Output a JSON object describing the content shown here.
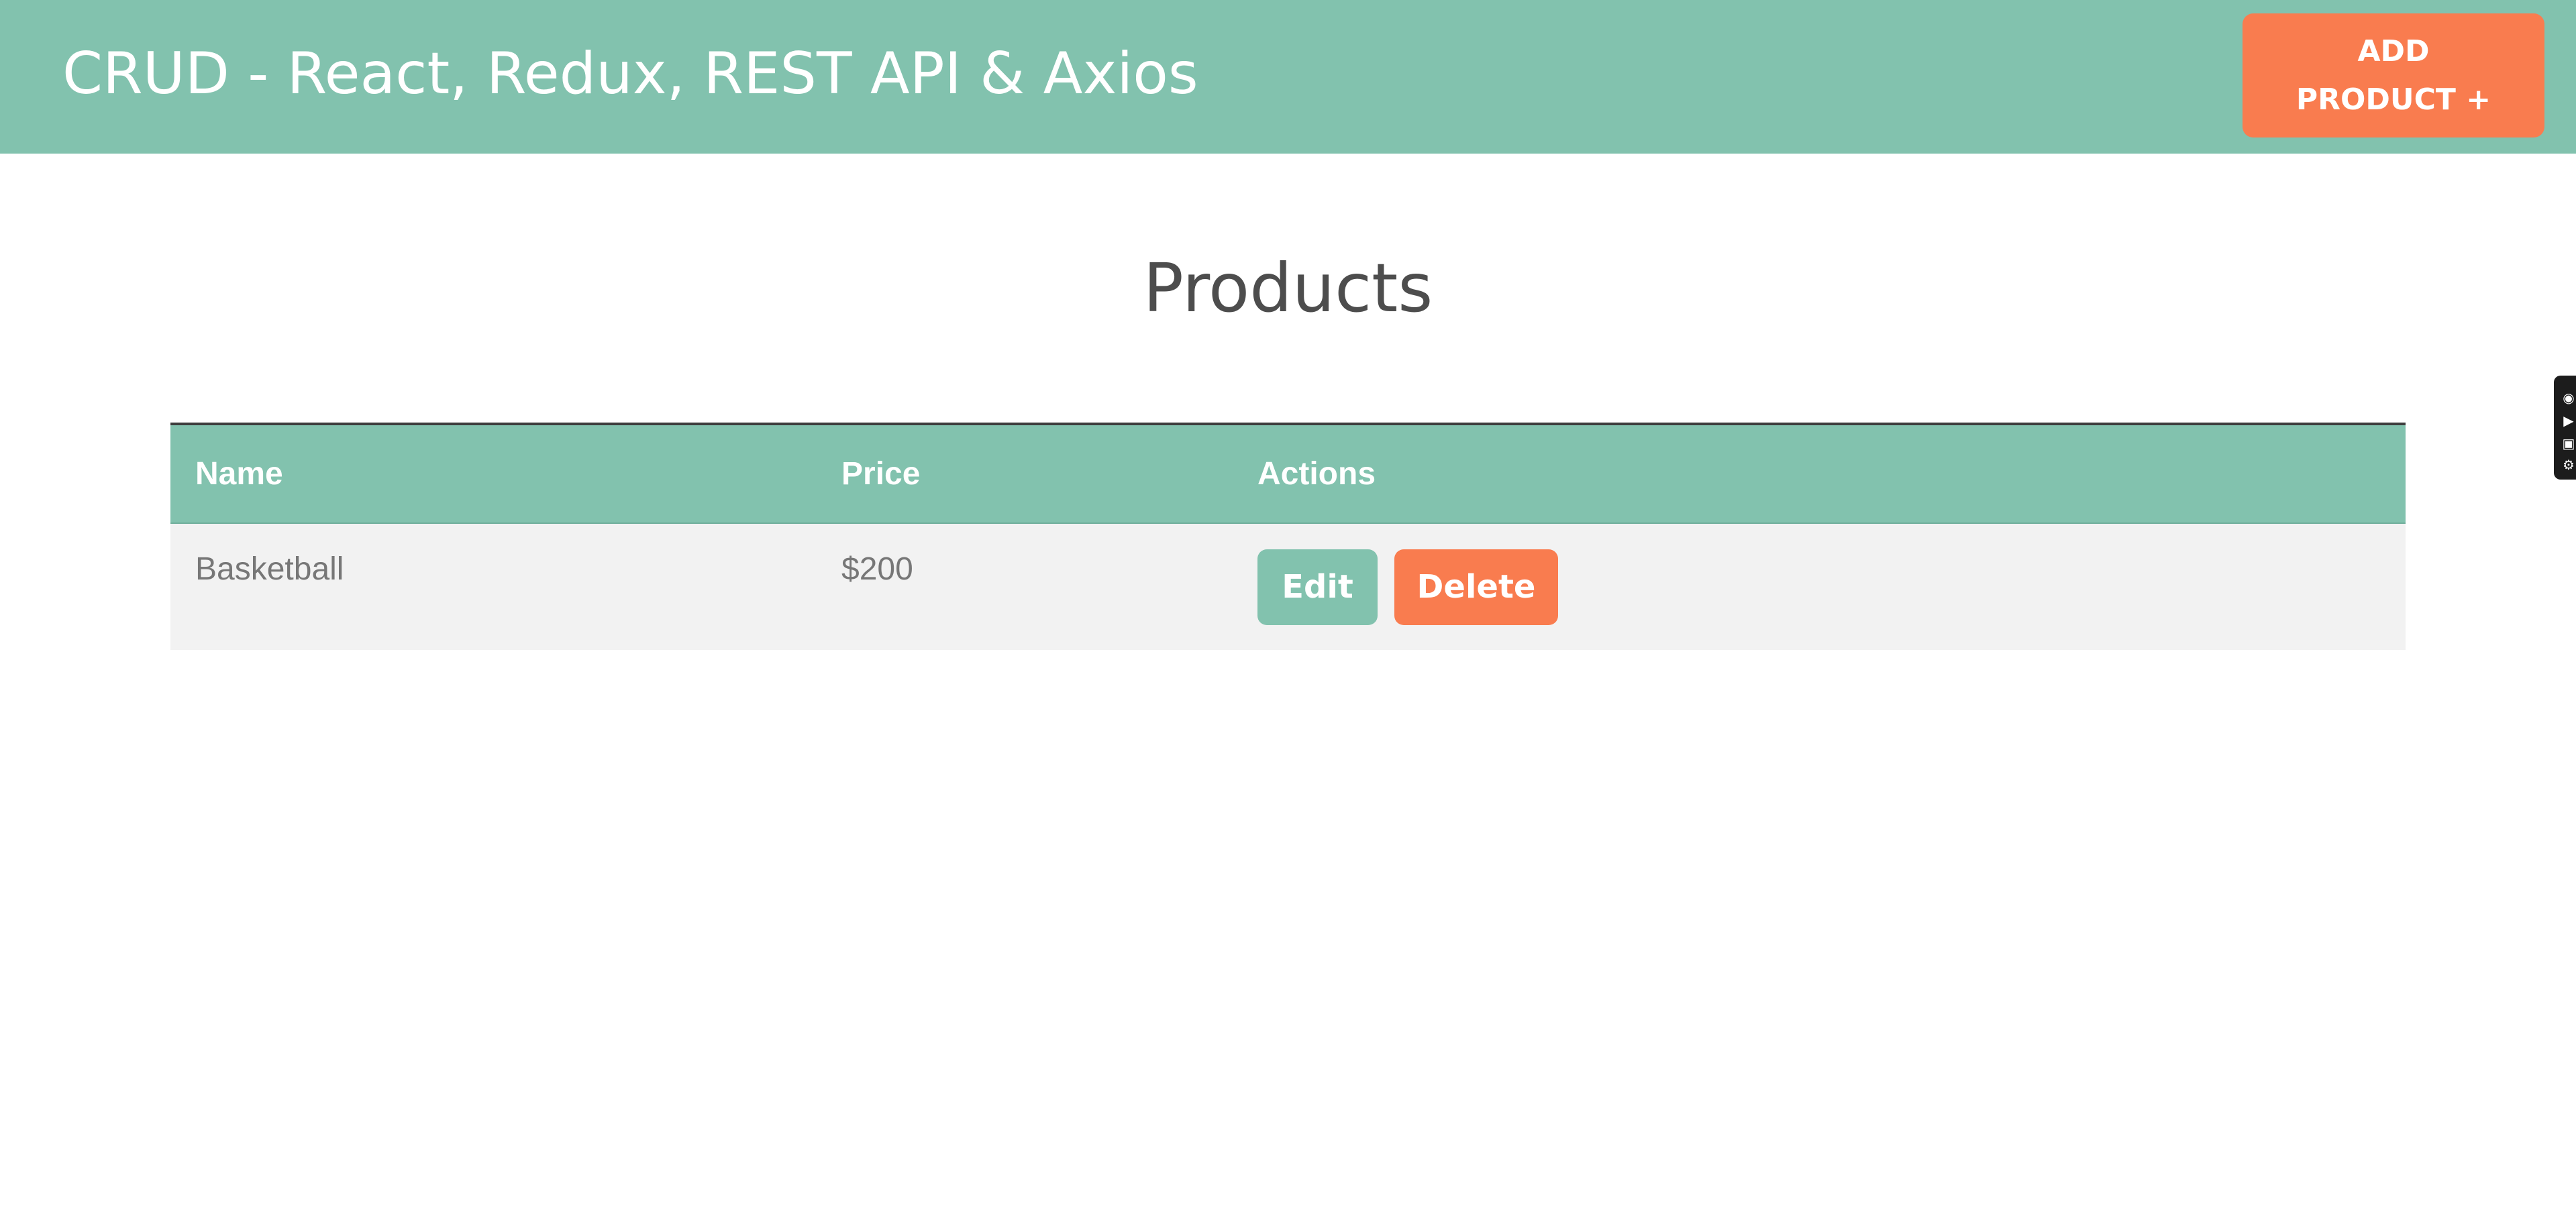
{
  "header": {
    "title": "CRUD - React, Redux, REST API & Axios",
    "add_button_label": "ADD PRODUCT +"
  },
  "main": {
    "heading": "Products",
    "table": {
      "columns": [
        "Name",
        "Price",
        "Actions"
      ],
      "rows": [
        {
          "name": "Basketball",
          "price": "$200",
          "edit_label": "Edit",
          "delete_label": "Delete"
        }
      ]
    }
  },
  "side_widget": {
    "icons": [
      "camera-icon",
      "video-icon",
      "image-icon",
      "gear-icon"
    ]
  },
  "colors": {
    "primary": "#82c2ae",
    "accent": "#f97c4f",
    "heading_text": "#4d4d4d",
    "row_background": "#f2f2f2"
  }
}
